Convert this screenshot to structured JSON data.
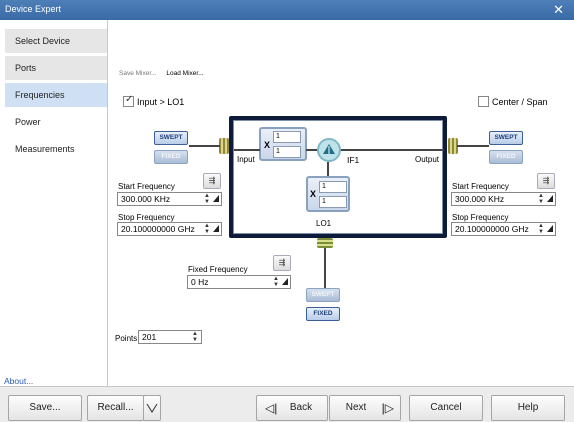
{
  "window": {
    "title": "Device Expert",
    "close_glyph": "✕"
  },
  "sidebar": {
    "items": [
      {
        "label": "Select Device"
      },
      {
        "label": "Ports"
      },
      {
        "label": "Frequencies"
      },
      {
        "label": "Power"
      },
      {
        "label": "Measurements"
      }
    ],
    "about_link": "About..."
  },
  "toolbar": {
    "save_mixer": "Save Mixer...",
    "load_mixer": "Load Mixer..."
  },
  "options": {
    "input_gt_lo1": {
      "label": "Input > LO1",
      "checked": true
    },
    "center_span": {
      "label": "Center / Span",
      "checked": false
    }
  },
  "input": {
    "swept_label": "SWEPT",
    "fixed_label": "FIXED",
    "start_label": "Start Frequency",
    "start_value": "300.000 KHz",
    "stop_label": "Stop Frequency",
    "stop_value": "20.100000000 GHz"
  },
  "output": {
    "swept_label": "SWEPT",
    "fixed_label": "FIXED",
    "start_label": "Start Frequency",
    "start_value": "300.000 KHz",
    "stop_label": "Stop Frequency",
    "stop_value": "20.100000000 GHz"
  },
  "lo1": {
    "swept_label": "SWEPT",
    "fixed_label": "FIXED",
    "fixed_freq_label": "Fixed Frequency",
    "fixed_freq_value": "0 Hz"
  },
  "mixer": {
    "input_label": "Input",
    "output_label": "Output",
    "if_label": "IF1",
    "lo_label": "LO1",
    "in_mult_num": "1",
    "in_mult_den": "1",
    "lo_mult_num": "1",
    "lo_mult_den": "1",
    "x_glyph": "X"
  },
  "points": {
    "label": "Points",
    "value": "201"
  },
  "footer": {
    "save": "Save...",
    "recall": "Recall...",
    "back": "Back",
    "next": "Next",
    "cancel": "Cancel",
    "help": "Help"
  },
  "colors": {
    "title_bar": "#3a6aa6",
    "active_nav": "#cfe0f5",
    "mixer_frame": "#0d1a3a"
  }
}
